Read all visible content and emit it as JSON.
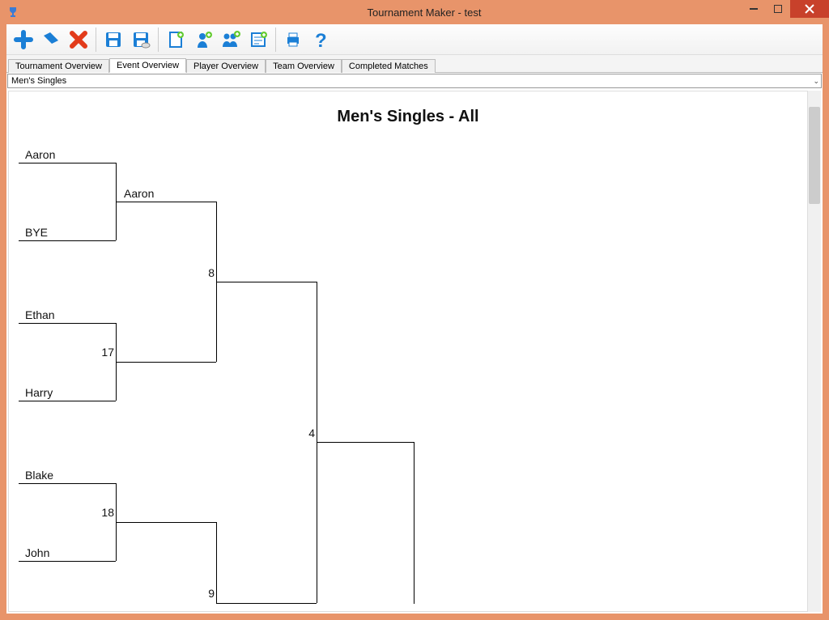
{
  "window": {
    "title": "Tournament Maker - test"
  },
  "tabs": {
    "t0": "Tournament Overview",
    "t1": "Event Overview",
    "t2": "Player Overview",
    "t3": "Team Overview",
    "t4": "Completed Matches"
  },
  "dropdown": {
    "selected": "Men's Singles"
  },
  "bracket": {
    "title": "Men's Singles - All",
    "r1": {
      "p0": "Aaron",
      "p1": "BYE",
      "p2": "Ethan",
      "p3": "Harry",
      "p4": "Blake",
      "p5": "John"
    },
    "r2": {
      "p0": "Aaron",
      "n0": "17",
      "n1": "18"
    },
    "r3": {
      "n0": "8",
      "n1": "9"
    },
    "r4": {
      "n0": "4"
    }
  }
}
